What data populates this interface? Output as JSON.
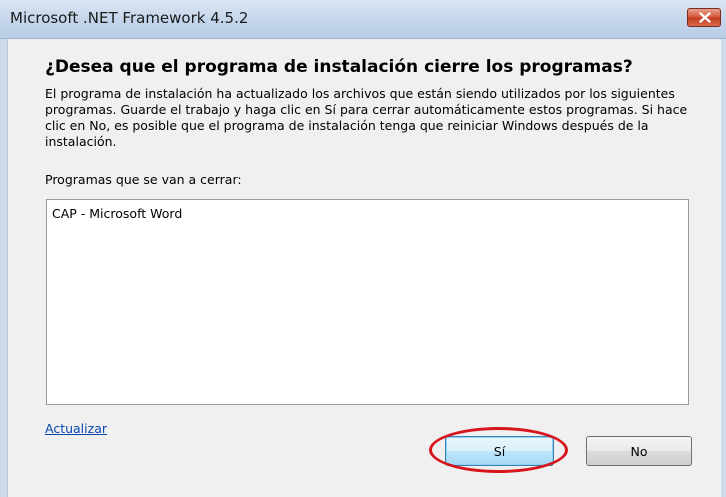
{
  "window": {
    "title": "Microsoft .NET Framework 4.5.2",
    "close_icon": "close-icon",
    "close_color": "#c23a20"
  },
  "dialog": {
    "heading": "¿Desea que el programa de instalación cierre los programas?",
    "description": "El programa de instalación ha actualizado los archivos que están siendo utilizados por los siguientes programas.  Guarde el trabajo y haga clic en Sí para cerrar automáticamente estos programas.  Si hace clic en No, es posible que el programa de instalación tenga que reiniciar Windows después de la instalación.",
    "list_label": "Programas que se van a cerrar:",
    "programs": [
      "CAP - Microsoft Word"
    ],
    "refresh_link": "Actualizar",
    "yes_label": "Sí",
    "no_label": "No"
  },
  "annotation": {
    "highlight_color": "#d6151c"
  }
}
